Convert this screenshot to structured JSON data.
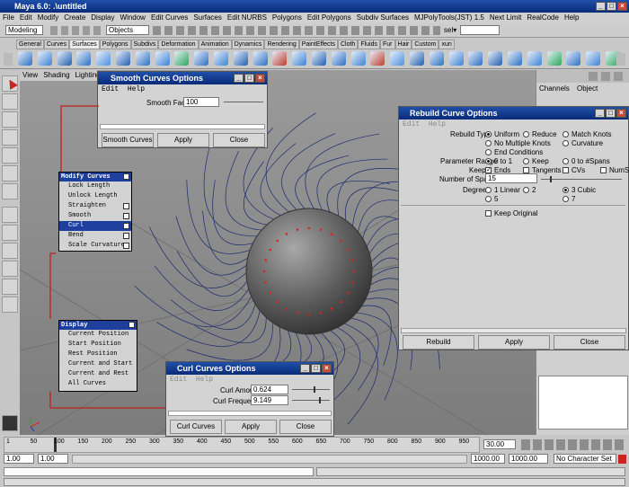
{
  "app": {
    "title": "Maya 6.0: .\\untitled"
  },
  "menu": [
    "File",
    "Edit",
    "Modify",
    "Create",
    "Display",
    "Window",
    "Edit Curves",
    "Surfaces",
    "Edit NURBS",
    "Polygons",
    "Edit Polygons",
    "Subdiv Surfaces",
    "MJPolyTools(JST) 1.5",
    "Next Limit",
    "RealCode",
    "Help"
  ],
  "statusline": {
    "mode": "Modeling",
    "objects": "Objects",
    "sel": "sel▾"
  },
  "shelf_tabs": [
    "General",
    "Curves",
    "Surfaces",
    "Polygons",
    "Subdivs",
    "Deformation",
    "Animation",
    "Dynamics",
    "Rendering",
    "PaintEffects",
    "Cloth",
    "Fluids",
    "Fur",
    "Hair",
    "Custom",
    "xun"
  ],
  "active_shelf": "Surfaces",
  "viewport_menu": [
    "View",
    "Shading",
    "Lighting",
    "Sh"
  ],
  "channels": {
    "menu": [
      "Channels",
      "Object"
    ]
  },
  "smooth_dialog": {
    "title": "Smooth Curves Options",
    "menu": [
      "Edit",
      "Help"
    ],
    "factor_label": "Smooth Factor",
    "factor_value": "100",
    "buttons": [
      "Smooth Curves",
      "Apply",
      "Close"
    ]
  },
  "modify_curves": {
    "title": "Modify Curves",
    "items": [
      "Lock Length",
      "Unlock Length",
      "Straighten",
      "Smooth",
      "Curl",
      "Bend",
      "Scale Curvature"
    ],
    "selected": "Curl"
  },
  "display_menu": {
    "title": "Display",
    "items": [
      "Current Position",
      "Start Position",
      "Rest Position",
      "Current and Start",
      "Current and Rest",
      "All Curves"
    ]
  },
  "curl_dialog": {
    "title": "Curl Curves Options",
    "menu": [
      "Edit",
      "Help"
    ],
    "amount_label": "Curl Amount",
    "amount_value": "0.624",
    "frequency_label": "Curl Frequency",
    "frequency_value": "9.149",
    "buttons": [
      "Curl Curves",
      "Apply",
      "Close"
    ]
  },
  "rebuild_dialog": {
    "title": "Rebuild Curve Options",
    "menu": [
      "Edit",
      "Help"
    ],
    "rebuild_type_label": "Rebuild Type",
    "rebuild_types": [
      "Uniform",
      "Reduce",
      "Match Knots",
      "No Multiple Knots",
      "Curvature",
      "End Conditions"
    ],
    "param_range_label": "Parameter Range",
    "param_ranges": [
      "0 to 1",
      "Keep",
      "0 to #Spans"
    ],
    "keep_label": "Keep",
    "keep_opts": [
      "Ends",
      "Tangents",
      "CVs",
      "NumSpans"
    ],
    "spans_label": "Number of Spans",
    "spans_value": "15",
    "degree_label": "Degree",
    "degrees": [
      "1 Linear",
      "2",
      "3 Cubic",
      "5",
      "7"
    ],
    "keep_original": "Keep Original",
    "buttons": [
      "Rebuild",
      "Apply",
      "Close"
    ]
  },
  "timeline": {
    "ticks": [
      "1",
      "50",
      "100",
      "150",
      "200",
      "250",
      "300",
      "350",
      "400",
      "450",
      "500",
      "550",
      "600",
      "650",
      "700",
      "750",
      "800",
      "850",
      "900",
      "950"
    ],
    "current": "30.00"
  },
  "range": {
    "start": "1.00",
    "start2": "1.00",
    "end": "1000.00",
    "end2": "1000.00",
    "charset": "No Character Set"
  },
  "colors": {
    "titlebar": "#0a2b78",
    "viewport": "#8c8c8c",
    "selected": "#1f3f9c",
    "curves": "#1a2a6e"
  }
}
